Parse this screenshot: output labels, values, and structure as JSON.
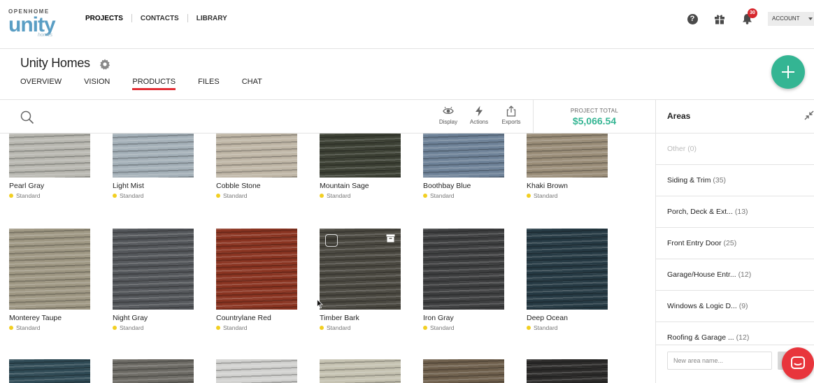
{
  "brand": {
    "top": "OPENHOME",
    "main": "unity",
    "sub": "homes"
  },
  "main_nav": [
    "PROJECTS",
    "CONTACTS",
    "LIBRARY"
  ],
  "top_bar": {
    "notification_count": "30",
    "account_label": "ACCOUNT",
    "icons": [
      "help-icon",
      "gift-icon",
      "bell-icon"
    ]
  },
  "project": {
    "title": "Unity Homes",
    "tabs": [
      "OVERVIEW",
      "VISION",
      "PRODUCTS",
      "FILES",
      "CHAT"
    ],
    "active_tab": "PRODUCTS"
  },
  "toolbar": {
    "display_label": "Display",
    "actions_label": "Actions",
    "exports_label": "Exports",
    "total_label": "PROJECT TOTAL",
    "total_value": "$5,066.54"
  },
  "products": {
    "row1": [
      {
        "name": "Pearl Gray",
        "status": "Standard",
        "color": "#b9b8b1"
      },
      {
        "name": "Light Mist",
        "status": "Standard",
        "color": "#a4b0b8"
      },
      {
        "name": "Cobble Stone",
        "status": "Standard",
        "color": "#bfb6a6"
      },
      {
        "name": "Mountain Sage",
        "status": "Standard",
        "color": "#3c4034"
      },
      {
        "name": "Boothbay Blue",
        "status": "Standard",
        "color": "#6e8298"
      },
      {
        "name": "Khaki Brown",
        "status": "Standard",
        "color": "#9a8d78"
      }
    ],
    "row2": [
      {
        "name": "Monterey Taupe",
        "status": "Standard",
        "color": "#9e9783"
      },
      {
        "name": "Night Gray",
        "status": "Standard",
        "color": "#53565a"
      },
      {
        "name": "Countrylane Red",
        "status": "Standard",
        "color": "#8a3421"
      },
      {
        "name": "Timber Bark",
        "status": "Standard",
        "color": "#4a4840"
      },
      {
        "name": "Iron Gray",
        "status": "Standard",
        "color": "#3e3f40"
      },
      {
        "name": "Deep Ocean",
        "status": "Standard",
        "color": "#263a44"
      }
    ],
    "row3_colors": [
      "#2f4a55",
      "#6c6a64",
      "#d2d2d0",
      "#c5c2b1",
      "#6e5f4c",
      "#2c2b2a"
    ]
  },
  "areas": {
    "title": "Areas",
    "items": [
      {
        "label": "Other",
        "count": "(0)"
      },
      {
        "label": "Siding & Trim",
        "count": "(35)"
      },
      {
        "label": "Porch, Deck & Ext...",
        "count": "(13)"
      },
      {
        "label": "Front Entry Door",
        "count": "(25)"
      },
      {
        "label": "Garage/House Entr...",
        "count": "(12)"
      },
      {
        "label": "Windows & Logic D...",
        "count": "(9)"
      },
      {
        "label": "Roofing & Garage ...",
        "count": "(12)"
      }
    ],
    "new_placeholder": "New area name..."
  },
  "colors": {
    "accent_green": "#34b593",
    "tab_underline": "#e22f36",
    "badge_red": "#d7272d",
    "status_dot": "#f2cf22"
  }
}
